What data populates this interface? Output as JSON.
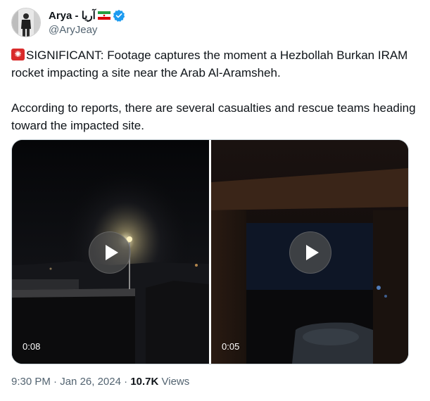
{
  "author": {
    "display_name": "Arya - آریا",
    "handle": "@AryJeay",
    "flag_icon": "iran-flag-icon",
    "verified_icon": "verified-badge-icon",
    "verified_color": "#1d9bf0"
  },
  "tweet": {
    "paragraph1": "SIGNIFICANT: Footage captures the moment a Hezbollah Burkan IRAM rocket impacting a site near the Arab Al-Aramsheh.",
    "paragraph2": "According to reports, there are several casualties and rescue teams heading toward the impacted site.",
    "siren_icon": "rotating-light-icon"
  },
  "media": {
    "videos": [
      {
        "duration": "0:08",
        "play_icon": "play-icon"
      },
      {
        "duration": "0:05",
        "play_icon": "play-icon"
      }
    ]
  },
  "meta": {
    "time": "9:30 PM",
    "separator": "·",
    "date": "Jan 26, 2024",
    "views_count": "10.7K",
    "views_label": "Views"
  },
  "colors": {
    "text_primary": "#0f1419",
    "text_secondary": "#536471",
    "border": "#cfd9de"
  }
}
